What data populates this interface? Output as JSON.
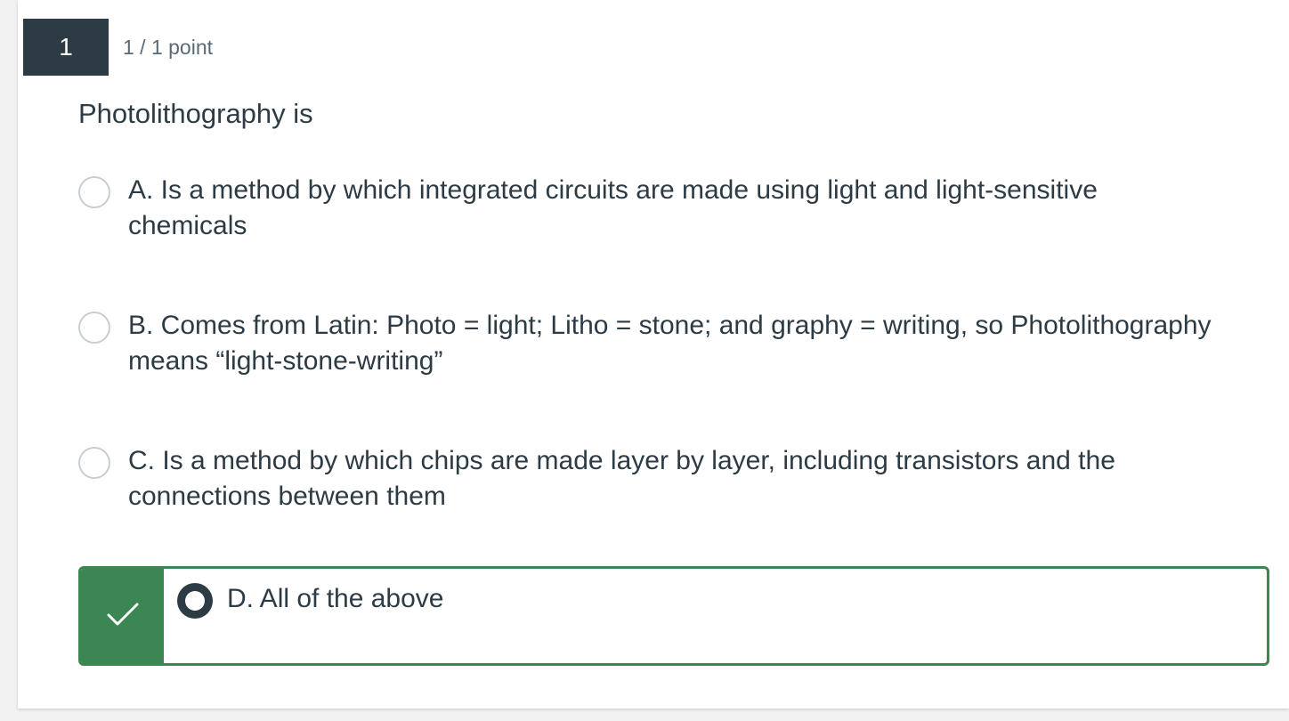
{
  "question": {
    "number": "1",
    "points": "1 / 1 point",
    "prompt": "Photolithography is"
  },
  "answers": [
    {
      "line1": "A. Is a method by which integrated circuits are made using light and light-sensitive",
      "line2": "chemicals",
      "selected": false
    },
    {
      "line1": "B. Comes from Latin: Photo = light; Litho = stone; and graphy = writing, so Photolithography",
      "line2": "means “light-stone-writing”",
      "selected": false
    },
    {
      "line1": "C. Is a method by which chips are made layer by layer, including transistors and the",
      "line2": "connections between them",
      "selected": false
    },
    {
      "line1": "D. All of the above",
      "selected": true,
      "correct": true
    }
  ],
  "colors": {
    "dark": "#2d3b45",
    "correct": "#3c8653",
    "radio_border": "#c7cdd1"
  },
  "icons": {
    "correct_indicator": "checkmark-icon"
  }
}
